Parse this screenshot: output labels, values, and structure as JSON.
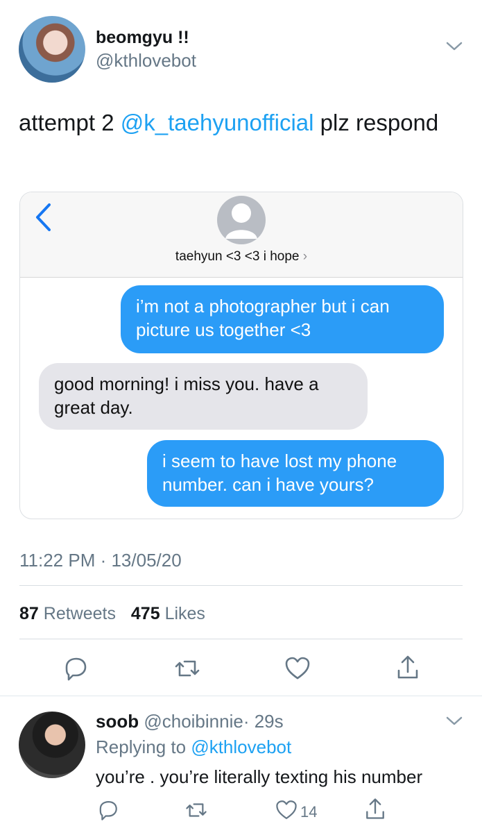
{
  "tweet": {
    "name": "beomgyu !!",
    "handle": "@kthlovebot",
    "text_prefix": "attempt 2 ",
    "mention": "@k_taehyunofficial",
    "text_suffix": " plz respond",
    "timestamp": "11:22 PM · 13/05/20",
    "retweets_count": "87",
    "retweets_label": "Retweets",
    "likes_count": "475",
    "likes_label": "Likes"
  },
  "message_screenshot": {
    "contact_name": "taehyun <3 <3 i hope",
    "messages": [
      {
        "text": "i’m not a photographer but i can picture us together <3"
      },
      {
        "text": "good morning! i miss you. have a great day."
      },
      {
        "text": "i seem to have lost my phone number. can i have yours?"
      }
    ]
  },
  "reply": {
    "name": "soob",
    "handle": "@choibinnie",
    "time": "· 29s",
    "replying_to_label": "Replying to",
    "replying_to_handle": "@kthlovebot",
    "text": "you’re . you’re literally texting his number",
    "likes_count": "14"
  },
  "colors": {
    "link": "#1da1f2",
    "message_blue": "#2b9cf7",
    "message_grey": "#e5e5ea"
  },
  "icons": {
    "more": "chevron-down-icon",
    "reply": "comment-icon",
    "retweet": "retweet-icon",
    "like": "heart-icon",
    "share": "share-icon",
    "back": "chevron-left-icon",
    "contact": "person-icon"
  }
}
